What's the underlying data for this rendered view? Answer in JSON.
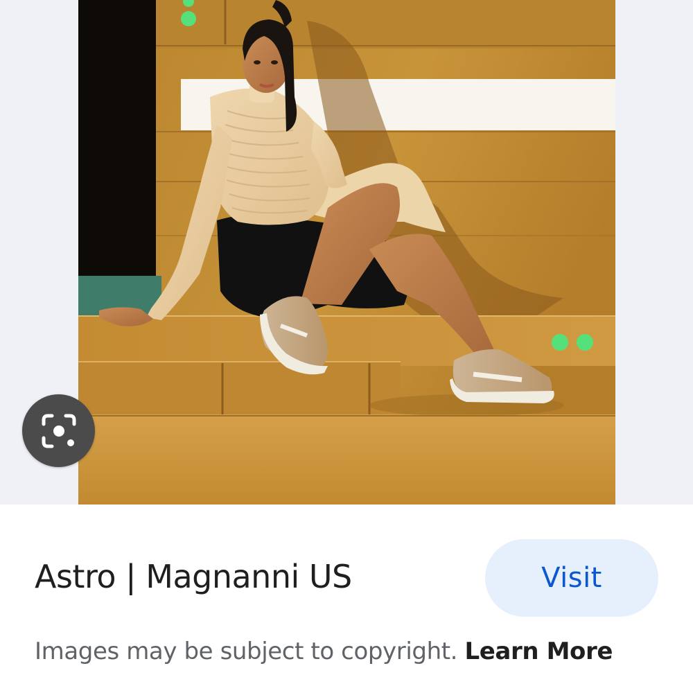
{
  "result": {
    "source_title": "Astro | Magnanni US",
    "visit_label": "Visit",
    "image_alt": "Model in a cream ribbed cropped top and black skirt sitting on wooden steps wearing beige suede sneakers"
  },
  "lens": {
    "icon": "lens-search-icon"
  },
  "footer": {
    "copyright_text": "Images may be subject to copyright.",
    "learn_more_label": "Learn More"
  },
  "colors": {
    "visit_text": "#0b57d0",
    "visit_background": "#e6effc",
    "viewer_background": "#eff1f6",
    "lens_button": "#4b4b4b"
  }
}
